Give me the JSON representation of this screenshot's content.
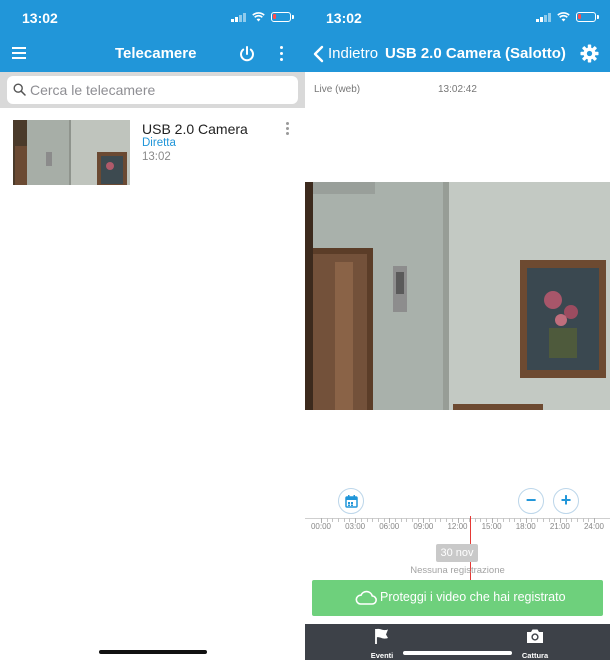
{
  "left": {
    "status_time": "13:02",
    "title": "Telecamere",
    "search_placeholder": "Cerca le telecamere",
    "camera": {
      "name": "USB 2.0 Camera",
      "status": "Diretta",
      "time": "13:02"
    }
  },
  "right": {
    "status_time": "13:02",
    "back_label": "Indietro",
    "title": "USB 2.0 Camera (Salotto)",
    "live_label": "Live (web)",
    "live_time": "13:02:42",
    "zoom_out_label": "−",
    "zoom_in_label": "+",
    "timeline_hours": [
      "00:00",
      "03:00",
      "06:00",
      "09:00",
      "12:00",
      "15:00",
      "18:00",
      "21:00",
      "24:00"
    ],
    "timeline_position": 0.545,
    "date_badge": "30 nov",
    "no_recording": "Nessuna registrazione",
    "protect_label": "Proteggi i video che hai registrato",
    "tabs": [
      {
        "label": "Eventi",
        "icon": "flag-icon"
      },
      {
        "label": "Cattura",
        "icon": "camera-icon"
      }
    ]
  },
  "colors": {
    "primary": "#2196d9",
    "accent_green": "#6ed07c",
    "bottom_bar": "#3d4148",
    "timeline_marker": "#e53935"
  },
  "icons": [
    "hamburger-menu-icon",
    "power-icon",
    "more-vert-icon",
    "search-icon",
    "back-chevron-icon",
    "gear-icon",
    "calendar-icon",
    "cloud-icon",
    "flag-icon",
    "camera-icon",
    "signal-icon",
    "wifi-icon",
    "battery-icon"
  ]
}
